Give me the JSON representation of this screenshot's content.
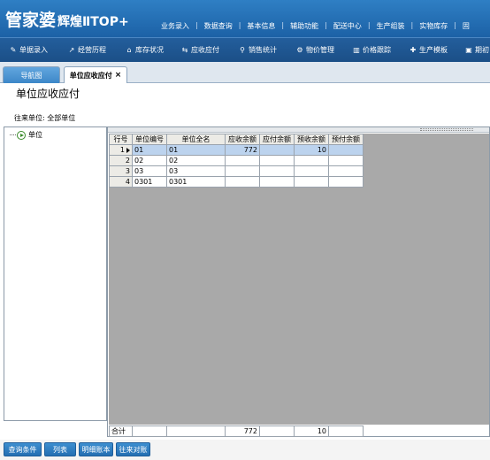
{
  "app": {
    "logo_main": "管家婆",
    "logo_sub": "辉煌ⅡTOP+"
  },
  "top_menu": [
    "业务录入",
    "数据查询",
    "基本信息",
    "辅助功能",
    "配送中心",
    "生产组装",
    "实物库存",
    "固"
  ],
  "toolbar": [
    "单据录入",
    "经营历程",
    "库存状况",
    "应收应付",
    "销售统计",
    "物价管理",
    "价格跟踪",
    "生产模板",
    "期初"
  ],
  "tabs": {
    "nav": "导航图",
    "active": "单位应收应付",
    "close": "×"
  },
  "page": {
    "title": "单位应收应付",
    "filter_label": "往来单位",
    "filter_value": "全部单位"
  },
  "tree": {
    "root": "单位"
  },
  "grid": {
    "columns": [
      "行号",
      "单位编号",
      "单位全名",
      "应收余额",
      "应付余额",
      "预收余额",
      "预付余额"
    ],
    "rows": [
      {
        "no": "1",
        "code": "01",
        "name": "01",
        "receivable": "772",
        "payable": "",
        "advance_received": "10",
        "advance_paid": ""
      },
      {
        "no": "2",
        "code": "02",
        "name": "02",
        "receivable": "",
        "payable": "",
        "advance_received": "",
        "advance_paid": ""
      },
      {
        "no": "3",
        "code": "03",
        "name": "03",
        "receivable": "",
        "payable": "",
        "advance_received": "",
        "advance_paid": ""
      },
      {
        "no": "4",
        "code": "0301",
        "name": "0301",
        "receivable": "",
        "payable": "",
        "advance_received": "",
        "advance_paid": ""
      }
    ],
    "totals": {
      "label": "合计",
      "receivable": "772",
      "advance_received": "10"
    }
  },
  "buttons": [
    "查询条件",
    "列表",
    "明细账本",
    "往来对账"
  ],
  "colors": {
    "header_blue": "#1c61a6",
    "button_blue": "#2e7cc0",
    "selected_row": "#bcd3ee"
  }
}
